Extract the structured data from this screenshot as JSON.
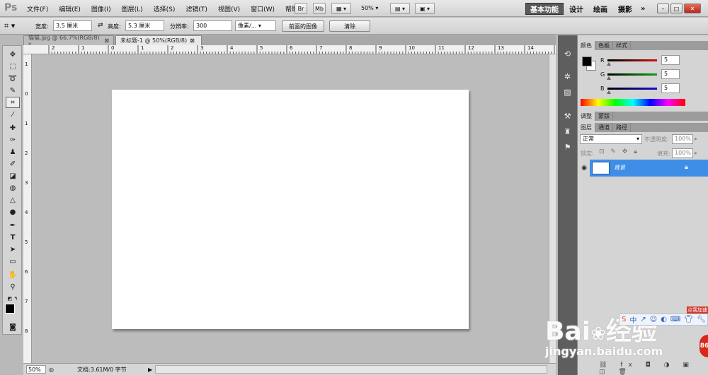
{
  "app": {
    "logo": "Ps"
  },
  "menu": [
    "文件(F)",
    "编辑(E)",
    "图像(I)",
    "图层(L)",
    "选择(S)",
    "滤镜(T)",
    "视图(V)",
    "窗口(W)",
    "帮助(H)"
  ],
  "appbar": {
    "btn_br": "Br",
    "btn_mb": "Mb",
    "zoom": "50%"
  },
  "workspace": [
    "基本功能",
    "设计",
    "绘画",
    "摄影"
  ],
  "workspace_more": "»",
  "window_controls": {
    "min": "–",
    "max": "□",
    "close": "✕"
  },
  "options": {
    "width_label": "宽度:",
    "width_value": "3.5 厘米",
    "height_label": "高度:",
    "height_value": "5.3 厘米",
    "res_label": "分辨率:",
    "res_value": "300",
    "unit_value": "像素/...",
    "front_image": "前面的图像",
    "clear": "清除"
  },
  "doc_tabs": [
    {
      "label": "猫猫.jpg @ 66.7%(RGB/8) *",
      "active": false
    },
    {
      "label": "未标题-1 @ 50%(RGB/8)",
      "active": true
    }
  ],
  "ruler_h": [
    "2",
    "1",
    "0",
    "1",
    "2",
    "3",
    "4",
    "5",
    "6",
    "7",
    "8",
    "9",
    "10",
    "11",
    "12",
    "13",
    "14"
  ],
  "ruler_v": [
    "1",
    "0",
    "1",
    "2",
    "3",
    "4",
    "5",
    "6",
    "7",
    "8"
  ],
  "status": {
    "zoom": "50%",
    "doc": "文档:3.61M/0 字节"
  },
  "color_panel": {
    "tabs": [
      "颜色",
      "色板",
      "样式"
    ],
    "channels": [
      {
        "name": "R",
        "value": "5",
        "color": "#d01010"
      },
      {
        "name": "G",
        "value": "5",
        "color": "#10a010"
      },
      {
        "name": "B",
        "value": "5",
        "color": "#1010d0"
      }
    ]
  },
  "adjust_panel": {
    "tabs": [
      "调整",
      "蒙版"
    ]
  },
  "layers_panel": {
    "tabs": [
      "图层",
      "通道",
      "路径"
    ],
    "blend_mode": "正常",
    "opacity_label": "不透明度:",
    "opacity_value": "100%",
    "lock_label": "锁定:",
    "fill_label": "填充:",
    "fill_value": "100%",
    "layer_name": "背景"
  },
  "watermark": {
    "brand": "Bai",
    "brand_cn": "经验",
    "url": "jingyan.baidu.com",
    "badge": "点我加速",
    "counter": "86"
  },
  "colors": {
    "accent": "#3e8ee8",
    "dock": "#5e5e5e"
  }
}
